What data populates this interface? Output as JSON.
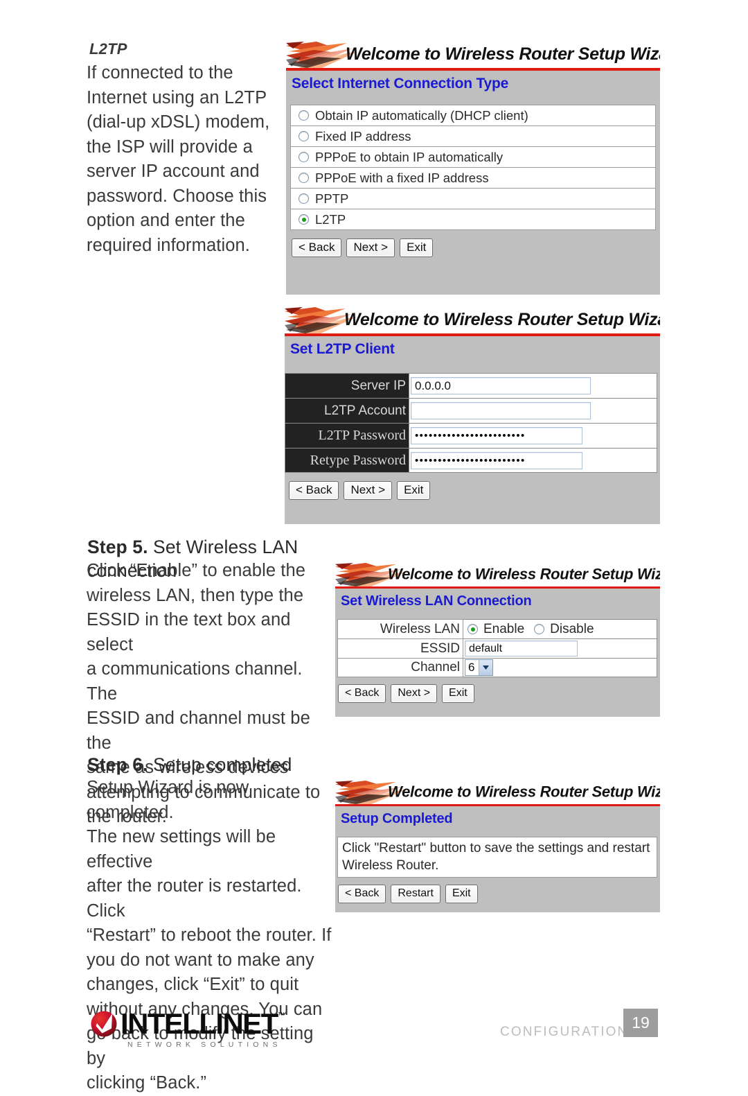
{
  "manual": {
    "l2tp_subhead": "L2TP",
    "l2tp_paragraph": "If connected to the\nInternet using an L2TP\n(dial-up xDSL) modem,\nthe ISP will provide a\nserver IP account and\npassword. Choose this\noption and enter the\nrequired information.",
    "step5_number": "Step 5.",
    "step5_title": " Set Wireless LAN connection",
    "step5_paragraph": "Click “Enable” to enable the\nwireless LAN, then type the\nESSID in the text box and select\na communications channel. The\nESSID and channel must be the\nsame as wireless devices\nattempting to communicate to\nthe router.",
    "step6_number": "Step 6.",
    "step6_title": " Setup completed",
    "step6_paragraph": "Setup Wizard is now completed.\nThe new settings will be effective\nafter the router is restarted. Click\n“Restart” to reboot the router. If\nyou do not want to make any\nchanges, click “Exit” to quit\nwithout any changes. You can\ngo back to modify the setting by\nclicking “Back.”"
  },
  "wizard_banner": "Welcome to Wireless Router Setup Wizard",
  "screens": {
    "connection_type": {
      "page_title": "Select Internet Connection Type",
      "options": [
        {
          "label": "Obtain IP automatically (DHCP client)",
          "selected": false
        },
        {
          "label": "Fixed IP address",
          "selected": false
        },
        {
          "label": "PPPoE to obtain IP automatically",
          "selected": false
        },
        {
          "label": "PPPoE with a fixed IP address",
          "selected": false
        },
        {
          "label": "PPTP",
          "selected": false
        },
        {
          "label": "L2TP",
          "selected": true
        }
      ],
      "buttons": [
        "< Back",
        "Next >",
        "Exit"
      ]
    },
    "l2tp_client": {
      "page_title": "Set L2TP Client",
      "fields": [
        {
          "label": "Server IP",
          "value": "0.0.0.0",
          "type": "text"
        },
        {
          "label": "L2TP Account",
          "value": "",
          "type": "text"
        },
        {
          "label": "L2TP Password",
          "value": "••••••••••••••••••••••••",
          "type": "password"
        },
        {
          "label": "Retype Password",
          "value": "••••••••••••••••••••••••",
          "type": "password"
        }
      ],
      "buttons": [
        "< Back",
        "Next >",
        "Exit"
      ]
    },
    "wireless_lan": {
      "page_title": "Set Wireless LAN Connection",
      "wireless_lan_label": "Wireless LAN",
      "enable_label": "Enable",
      "disable_label": "Disable",
      "wireless_lan_selected": "Enable",
      "essid_label": "ESSID",
      "essid_value": "default",
      "channel_label": "Channel",
      "channel_value": "6",
      "buttons": [
        "< Back",
        "Next >",
        "Exit"
      ]
    },
    "setup_completed": {
      "page_title": "Setup Completed",
      "message": "Click \"Restart\" button to save the settings and restart Wireless Router.",
      "buttons": [
        "< Back",
        "Restart",
        "Exit"
      ]
    }
  },
  "footer": {
    "logo_word": "INTELLINET",
    "logo_sub": "NETWORK SOLUTIONS",
    "section": "CONFIGURATION",
    "page_number": "19"
  }
}
